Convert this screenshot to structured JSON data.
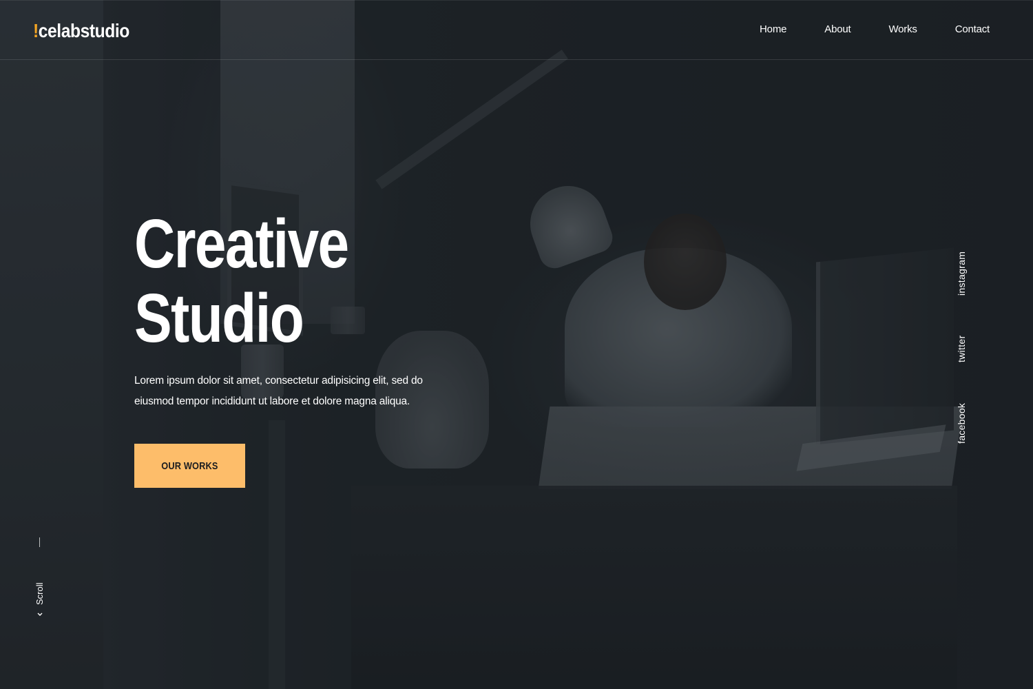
{
  "brand": {
    "logo_mark": "!",
    "logo_text": "celabstudio",
    "accent_color": "#f5a623"
  },
  "nav": {
    "items": [
      {
        "label": "Home"
      },
      {
        "label": "About"
      },
      {
        "label": "Works"
      },
      {
        "label": "Contact"
      }
    ]
  },
  "hero": {
    "title_line1": "Creative",
    "title_line2": "Studio",
    "description": "Lorem ipsum dolor sit amet, consectetur adipisicing elit, sed do eiusmod tempor incididunt ut labore et dolore magna aliqua.",
    "cta_label": "OUR WORKS",
    "cta_color": "#fdbd6a"
  },
  "social": {
    "items": [
      {
        "label": "instagram"
      },
      {
        "label": "twitter"
      },
      {
        "label": "facebook"
      }
    ]
  },
  "scroll": {
    "label": "Scroll",
    "icon": "chevron-down-icon"
  },
  "background": {
    "image": "photo-designer-at-desk-with-lamp"
  }
}
